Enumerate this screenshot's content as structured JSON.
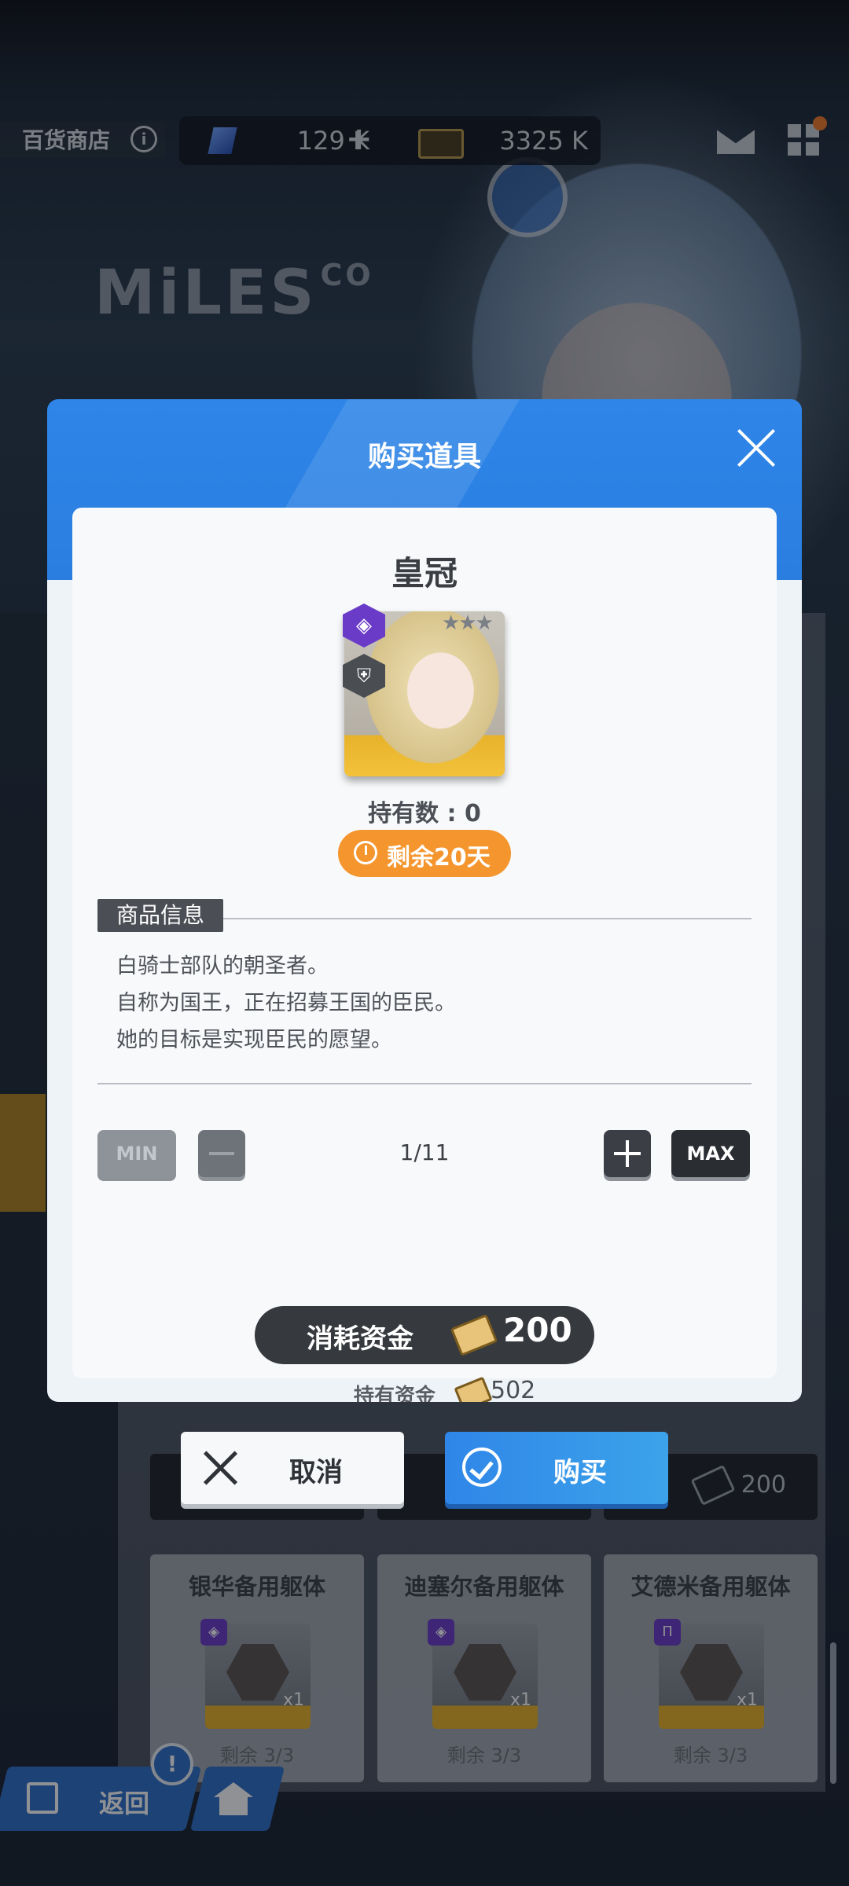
{
  "topbar": {
    "shop_title": "百货商店",
    "info_icon": "info-icon",
    "currency1_value": "129 K",
    "currency1_plus": "+",
    "currency2_value": "3325 K"
  },
  "background": {
    "logo_text": "MiLES",
    "logo_suffix": "CO",
    "bottom_price": "200",
    "cards": [
      {
        "name": "银华备用躯体",
        "badge": "◈",
        "count": "x1",
        "remain": "剩余 3/3"
      },
      {
        "name": "迪塞尔备用躯体",
        "badge": "◈",
        "count": "x1",
        "remain": "剩余 3/3"
      },
      {
        "name": "艾德米备用躯体",
        "badge": "Π",
        "count": "x1",
        "remain": "剩余 3/3"
      }
    ]
  },
  "bottom_nav": {
    "back_label": "返回",
    "alert": "!"
  },
  "modal": {
    "title": "购买道具",
    "item_name": "皇冠",
    "owned_label": "持有数 : 0",
    "remain_days": "剩余20天",
    "section_label": "商品信息",
    "description": [
      "白骑士部队的朝圣者。",
      "自称为国王，正在招募王国的臣民。",
      "她的目标是实现臣民的愿望。"
    ],
    "min_label": "MIN",
    "max_label": "MAX",
    "quantity": "1/11",
    "cost_label": "消耗资金",
    "cost_value": "200",
    "held_label": "持有资金",
    "held_value": "502",
    "class_badge": "◈",
    "shield_badge": "⛨",
    "stars": "★★★"
  },
  "actions": {
    "cancel_label": "取消",
    "buy_label": "购买"
  },
  "colors": {
    "primary_blue": "#2f86e8",
    "timer_orange": "#f5952d",
    "rarity_purple": "#6a3bc7",
    "dark_button": "#36393e"
  }
}
